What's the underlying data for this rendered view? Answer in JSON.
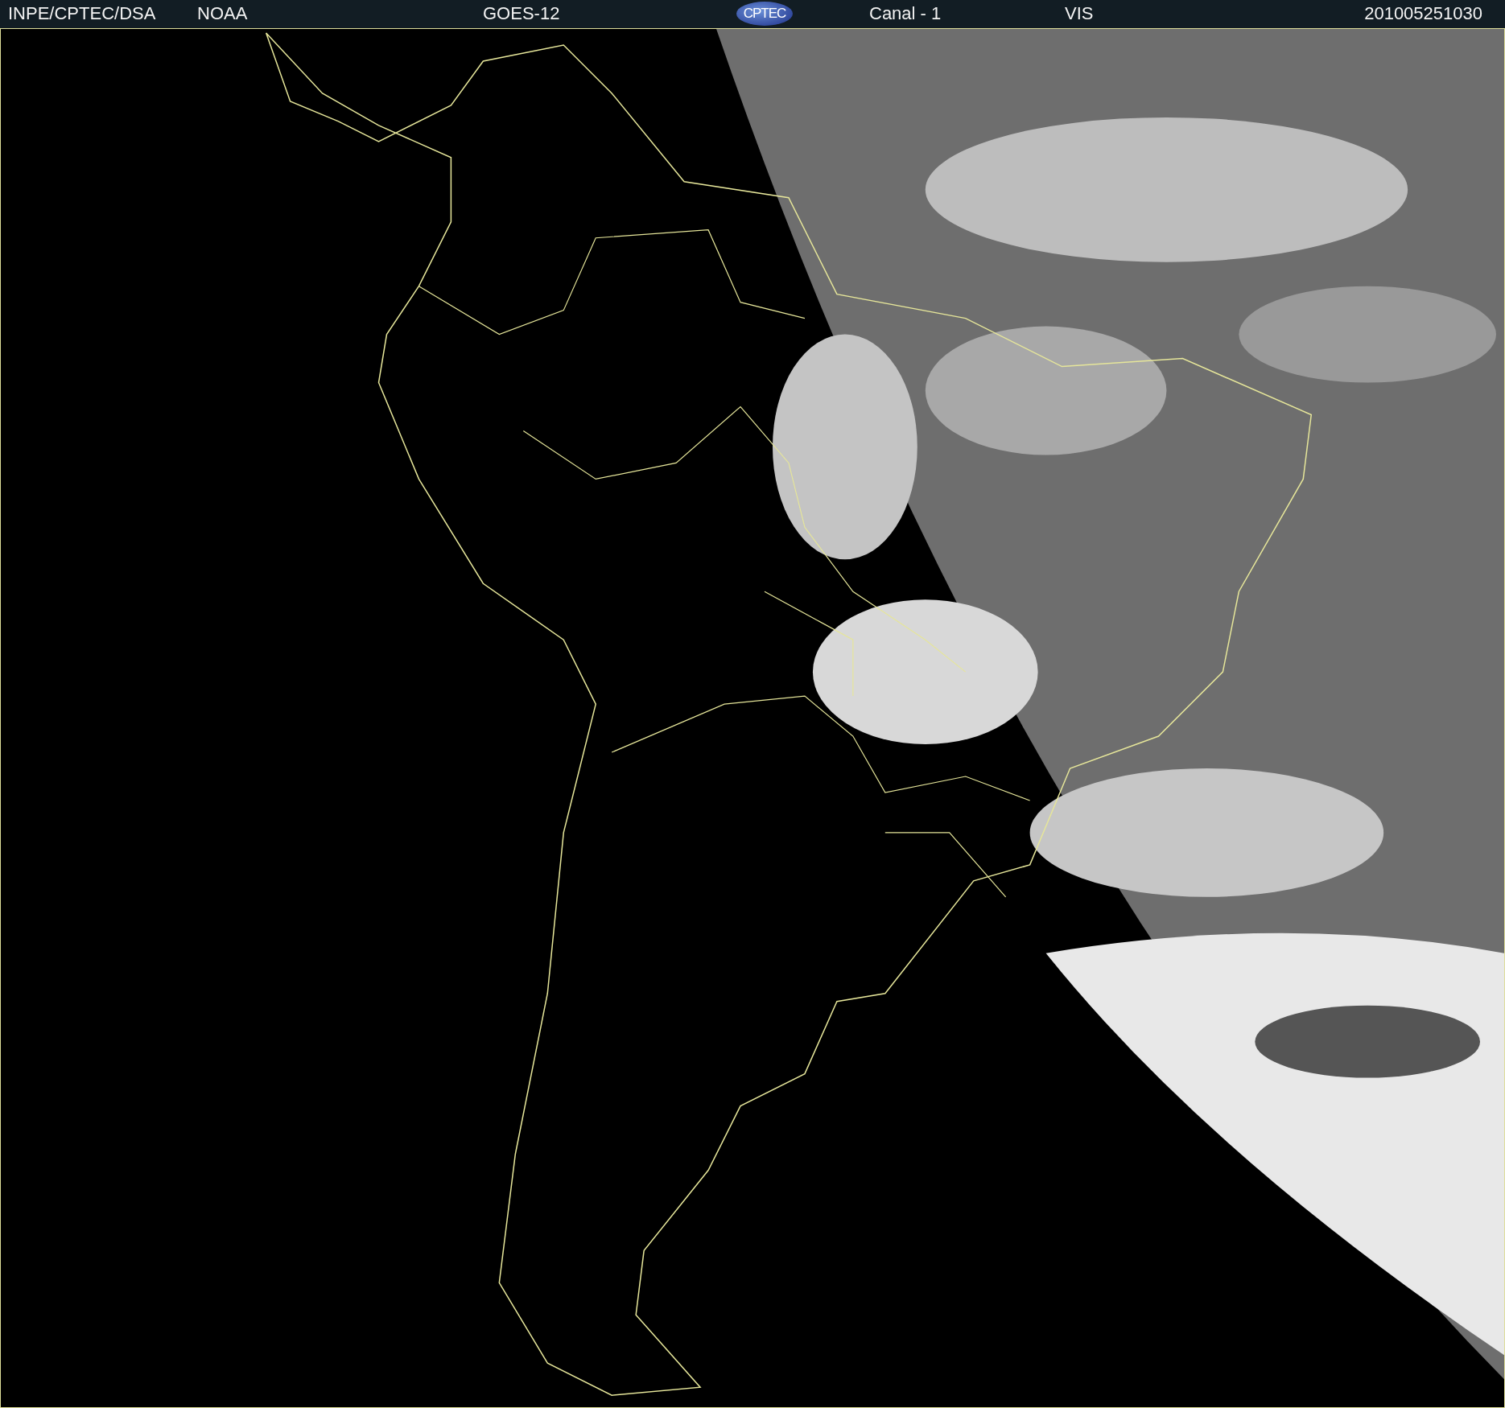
{
  "header": {
    "items": [
      {
        "kind": "text",
        "text": "INPE/CPTEC/DSA"
      },
      {
        "kind": "text",
        "text": "NOAA"
      },
      {
        "kind": "text",
        "text": "GOES-12"
      },
      {
        "kind": "logo",
        "text": "CPTEC"
      },
      {
        "kind": "text",
        "text": "Canal - 1"
      },
      {
        "kind": "text",
        "text": "VIS"
      },
      {
        "kind": "date",
        "text": "201005251030"
      }
    ]
  }
}
